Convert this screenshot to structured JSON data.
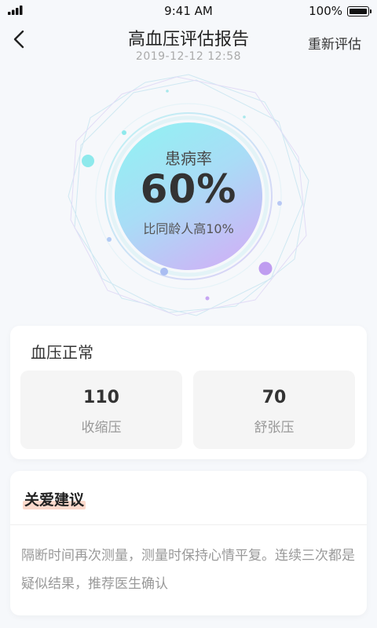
{
  "status_bar": {
    "time": "9:41 AM",
    "battery": "100%"
  },
  "header": {
    "title": "高血压评估报告",
    "date": "2019-12-12   12:58",
    "action_label": "重新评估"
  },
  "gauge": {
    "label": "患病率",
    "value": "60%",
    "subtitle": "比同龄人高10%",
    "colors": {
      "gradient_top": "#8ff4f2",
      "gradient_bottom": "#c9b8f6",
      "accent_purple": "#bf9df0",
      "accent_cyan": "#8ee9ec"
    }
  },
  "blood_pressure": {
    "status": "血压正常",
    "systolic": {
      "value": "110",
      "label": "收缩压"
    },
    "diastolic": {
      "value": "70",
      "label": "舒张压"
    }
  },
  "advice": {
    "title": "关爱建议",
    "body": "隔断时间再次测量，测量时保持心情平复。连续三次都是疑似结果，推荐医生确认"
  }
}
